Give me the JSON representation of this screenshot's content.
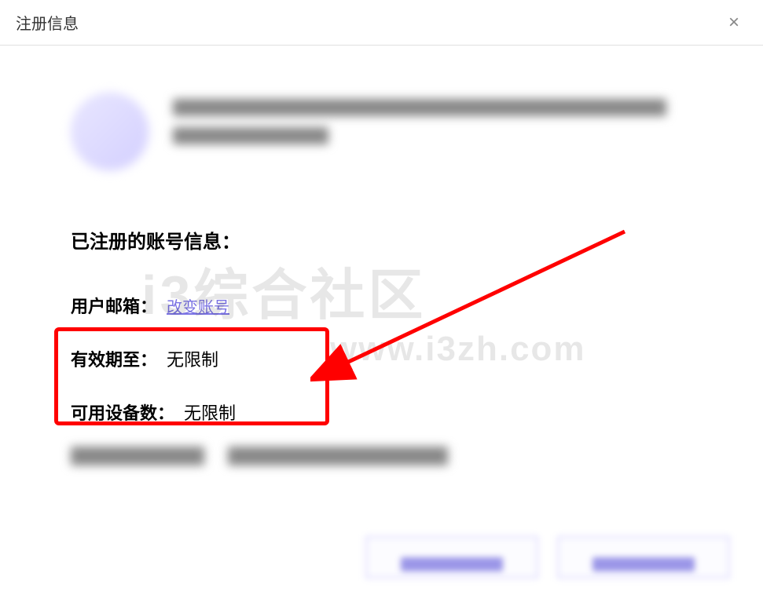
{
  "dialog": {
    "title": "注册信息",
    "close_symbol": "×"
  },
  "account": {
    "heading": "已注册的账号信息：",
    "email_label": "用户邮箱：",
    "change_account_link": "改变账号",
    "valid_until_label": "有效期至：",
    "valid_until_value": "无限制",
    "devices_label": "可用设备数：",
    "devices_value": "无限制"
  },
  "watermark": {
    "main": "i3综合社区",
    "url": "www.i3zh.com"
  }
}
